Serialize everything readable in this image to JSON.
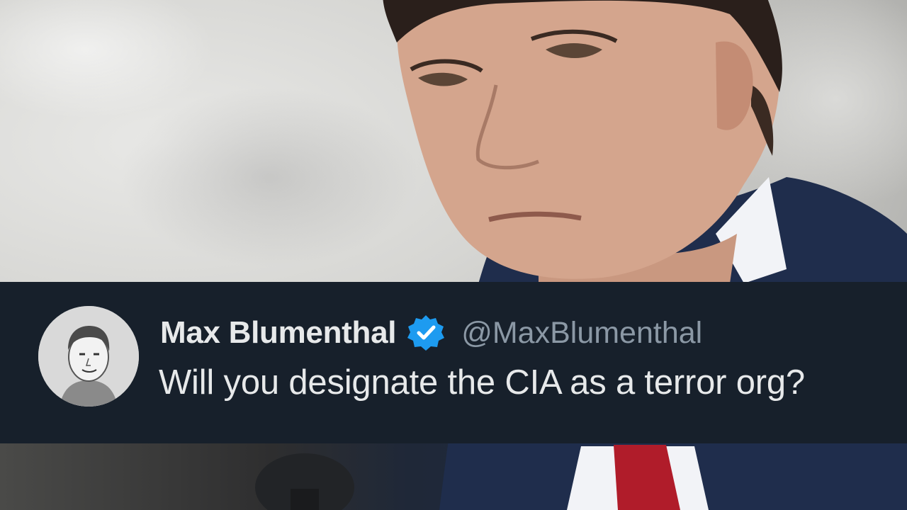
{
  "tweet": {
    "display_name": "Max Blumenthal",
    "handle": "@MaxBlumenthal",
    "text": "Will you designate the CIA as a terror org?",
    "verified": true,
    "verified_badge_color": "#1d9bf0"
  },
  "colors": {
    "bar_background": "#17202b",
    "name_text": "#e7e9ea",
    "handle_text": "#8b98a5"
  },
  "icons": {
    "verified": "verified-badge-icon",
    "avatar": "profile-avatar"
  }
}
